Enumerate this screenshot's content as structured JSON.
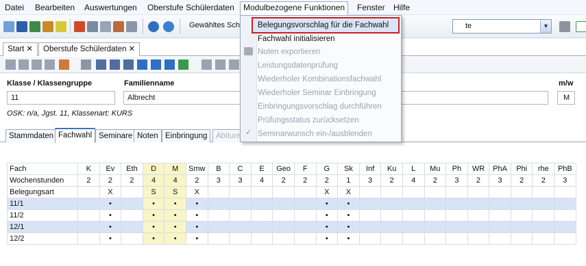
{
  "menu": [
    {
      "label": "Datei"
    },
    {
      "label": "Bearbeiten"
    },
    {
      "label": "Auswertungen"
    },
    {
      "label": "Oberstufe Schülerdaten"
    },
    {
      "label": "Modulbezogene Funktionen"
    },
    {
      "label": "Fenster"
    },
    {
      "label": "Hilfe"
    }
  ],
  "toolbar": {
    "selected_label": "Gewähltes Schu",
    "combo_value": "te"
  },
  "tabs": [
    {
      "label": "Start"
    },
    {
      "label": "Oberstufe Schülerdaten"
    }
  ],
  "form": {
    "klasse_label": "Klasse / Klassengruppe",
    "klasse_value": "11",
    "name_label": "Familienname",
    "name_value": "Albrecht",
    "mw_label": "m/w",
    "mw_value": "M",
    "osk_text": "OSK: n/a, Jgst. 11, Klassenart: KURS"
  },
  "subtabs": [
    {
      "label": "Stammdaten"
    },
    {
      "label": "Fachwahl"
    },
    {
      "label": "Seminare"
    },
    {
      "label": "Noten"
    },
    {
      "label": "Einbringung"
    },
    {
      "label": "Abiture"
    }
  ],
  "grid": {
    "columns": [
      "Fach",
      "K",
      "Ev",
      "Eth",
      "D",
      "M",
      "Smw",
      "B",
      "C",
      "E",
      "Geo",
      "F",
      "G",
      "Sk",
      "Inf",
      "Ku",
      "L",
      "Mu",
      "Ph",
      "WR",
      "PhA",
      "Phi",
      "rhe",
      "PhB"
    ],
    "rows": [
      {
        "label": "Wochenstunden",
        "cells": [
          "2",
          "2",
          "2",
          "4",
          "4",
          "2",
          "3",
          "3",
          "4",
          "2",
          "2",
          "2",
          "1",
          "3",
          "2",
          "4",
          "2",
          "3",
          "2",
          "3",
          "2",
          "2",
          "3"
        ]
      },
      {
        "label": "Belegungsart",
        "cells": [
          "",
          "X",
          "",
          "S",
          "S",
          "X",
          "",
          "",
          "",
          "",
          "",
          "X",
          "X",
          "",
          "",
          "",
          "",
          "",
          "",
          "",
          "",
          "",
          ""
        ]
      },
      {
        "label": "11/1",
        "cells": [
          "",
          "•",
          "",
          "•",
          "•",
          "•",
          "",
          "",
          "",
          "",
          "",
          "•",
          "•",
          "",
          "",
          "",
          "",
          "",
          "",
          "",
          "",
          "",
          ""
        ]
      },
      {
        "label": "11/2",
        "cells": [
          "",
          "•",
          "",
          "•",
          "•",
          "•",
          "",
          "",
          "",
          "",
          "",
          "•",
          "•",
          "",
          "",
          "",
          "",
          "",
          "",
          "",
          "",
          "",
          ""
        ]
      },
      {
        "label": "12/1",
        "cells": [
          "",
          "•",
          "",
          "•",
          "•",
          "•",
          "",
          "",
          "",
          "",
          "",
          "•",
          "•",
          "",
          "",
          "",
          "",
          "",
          "",
          "",
          "",
          "",
          ""
        ]
      },
      {
        "label": "12/2",
        "cells": [
          "",
          "•",
          "",
          "•",
          "•",
          "•",
          "",
          "",
          "",
          "",
          "",
          "•",
          "•",
          "",
          "",
          "",
          "",
          "",
          "",
          "",
          "",
          "",
          ""
        ]
      }
    ]
  },
  "dropdown": {
    "items": [
      {
        "label": "Belegungsvorschlag für die Fachwahl",
        "enabled": true
      },
      {
        "label": "Fachwahl initialisieren",
        "enabled": true
      },
      {
        "label": "Noten exportieren",
        "enabled": false
      },
      {
        "label": "Leistungsdatenprüfung",
        "enabled": false
      },
      {
        "label": "Wiederholer Kombinationsfachwahl",
        "enabled": false
      },
      {
        "label": "Wiederholer Seminar Einbringung",
        "enabled": false
      },
      {
        "label": "Einbringungsvorschlag durchführen",
        "enabled": false
      },
      {
        "label": "Prüfungsstatus zurücksetzen",
        "enabled": false
      },
      {
        "label": "Seminarwunsch ein-/ausblenden",
        "enabled": false
      }
    ]
  },
  "colors": {
    "highlight_border": "#c81e1e",
    "row_alt": "#d8e4f5",
    "yellow_col": "#f8f6c6"
  }
}
